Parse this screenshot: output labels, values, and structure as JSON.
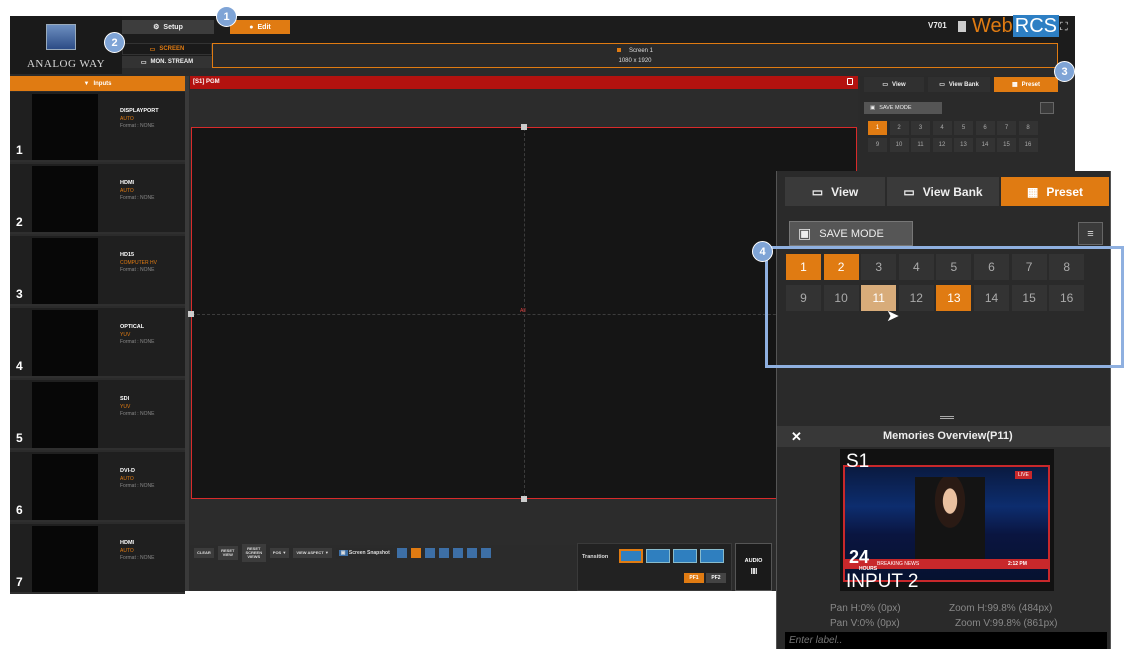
{
  "brand": {
    "logo_text": "ANALOG WAY",
    "webrcs_prefix": "Web",
    "webrcs_suffix": "RCS",
    "version": "V701"
  },
  "topbar": {
    "setup_label": "Setup",
    "edit_label": "Edit"
  },
  "screen_tabs": {
    "screen_label": "SCREEN",
    "mon_stream_label": "MON. STREAM"
  },
  "screen_info": {
    "name": "Screen 1",
    "resolution": "1080 x 1920"
  },
  "inputs": {
    "header": "Inputs",
    "items": [
      {
        "num": "1",
        "name": "DISPLAYPORT",
        "mode": "AUTO",
        "format": "Format : NONE"
      },
      {
        "num": "2",
        "name": "HDMI",
        "mode": "AUTO",
        "format": "Format : NONE"
      },
      {
        "num": "3",
        "name": "HD15",
        "mode": "COMPUTER HV",
        "format": "Format : NONE"
      },
      {
        "num": "4",
        "name": "OPTICAL",
        "mode": "YUV",
        "format": "Format : NONE"
      },
      {
        "num": "5",
        "name": "SDI",
        "mode": "YUV",
        "format": "Format : NONE"
      },
      {
        "num": "6",
        "name": "DVI-D",
        "mode": "AUTO",
        "format": "Format : NONE"
      },
      {
        "num": "7",
        "name": "HDMI",
        "mode": "AUTO",
        "format": "Format : NONE"
      }
    ]
  },
  "program": {
    "title": "[S1] PGM",
    "all_label": "All"
  },
  "toolbar": {
    "clear": "CLEAR",
    "reset_view": "RESET VIEW",
    "reset_screen_views": "RESET SCREEN VIEWS",
    "pos": "POS ▼",
    "view_aspect": "VIEW ASPECT ▼",
    "screen_snapshot": "Screen Snapshot"
  },
  "transition": {
    "label": "Transition",
    "pf1": "PF1",
    "pf2": "PF2",
    "audio": "AUDIO"
  },
  "right_panel": {
    "tabs": {
      "view": "View",
      "view_bank": "View Bank",
      "preset": "Preset"
    },
    "save_mode": "SAVE MODE",
    "mini_presets": [
      "1",
      "2",
      "3",
      "4",
      "5",
      "6",
      "7",
      "8",
      "9",
      "10",
      "11",
      "12",
      "13",
      "14",
      "15",
      "16"
    ]
  },
  "zoom_panel": {
    "tabs": {
      "view": "View",
      "view_bank": "View Bank",
      "preset": "Preset"
    },
    "save_mode": "SAVE MODE",
    "presets": [
      "1",
      "2",
      "3",
      "4",
      "5",
      "6",
      "7",
      "8",
      "9",
      "10",
      "11",
      "12",
      "13",
      "14",
      "15",
      "16"
    ],
    "active_presets": [
      "1",
      "2",
      "13"
    ],
    "hovered_preset": "11",
    "memories_title": "Memories Overview(P11)",
    "preview_screen": "S1",
    "preview_input": "INPUT 2",
    "preview_channel": "24",
    "preview_channel_sub": "HOURS",
    "preview_ticker": "BREAKING NEWS",
    "preview_live": "LIVE",
    "preview_time": "2:12 PM",
    "pan_h": "Pan H:0% (0px)",
    "pan_v": "Pan V:0% (0px)",
    "zoom_h": "Zoom H:99.8% (484px)",
    "zoom_v": "Zoom V:99.8% (861px)",
    "label_placeholder": "Enter label.."
  },
  "callouts": [
    "1",
    "2",
    "3",
    "4"
  ],
  "colors": {
    "accent": "#e07b12",
    "pgm_red": "#b3120f",
    "callout": "#7fa4d6"
  }
}
